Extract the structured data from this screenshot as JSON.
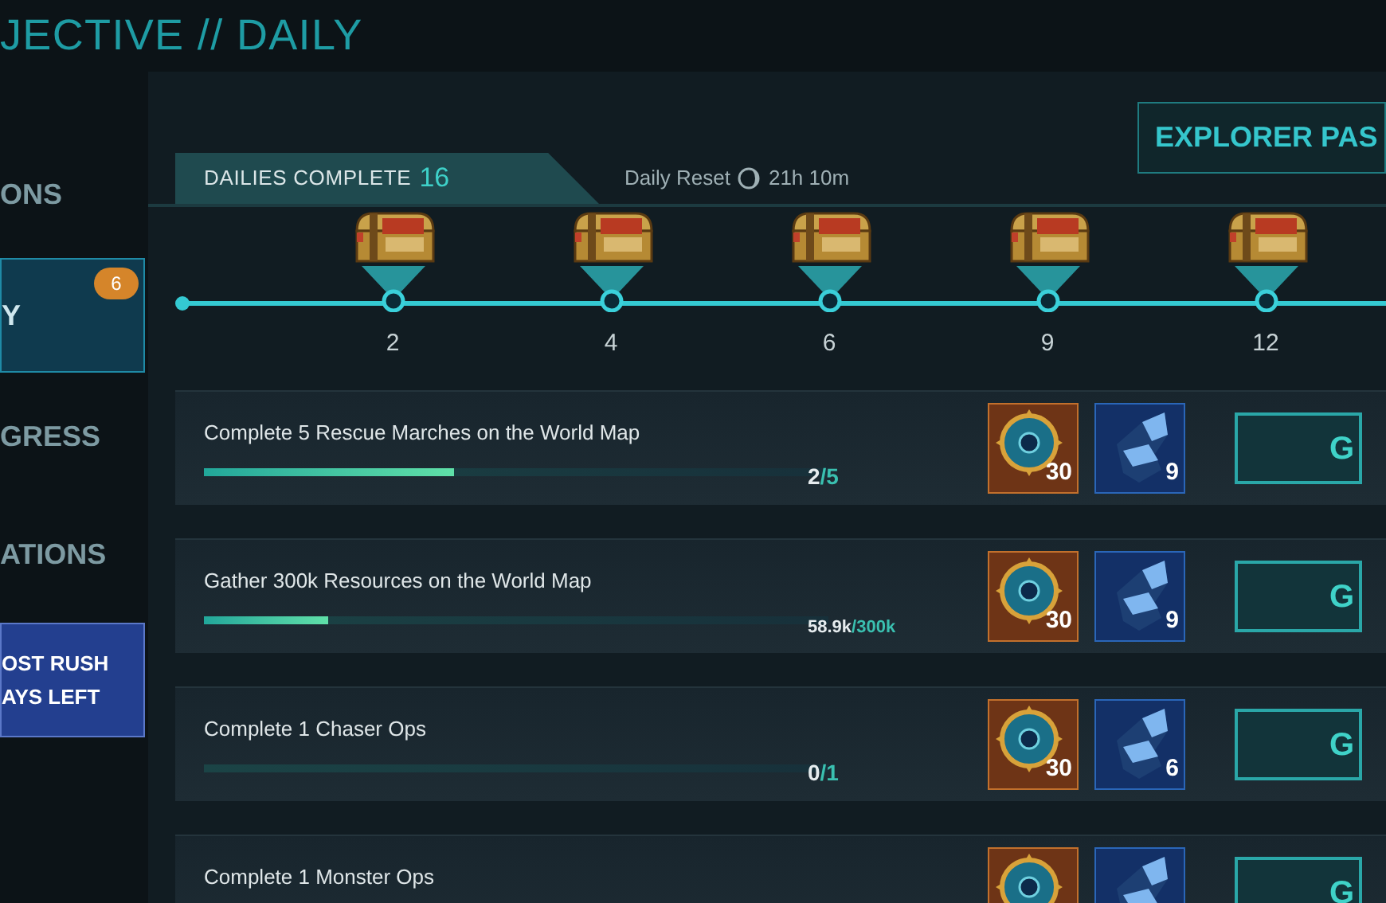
{
  "title": "JECTIVE // DAILY",
  "sidebar": {
    "items": [
      {
        "label": "ONS",
        "selected": false,
        "kind": "tab"
      },
      {
        "label": "Y",
        "selected": true,
        "kind": "tab",
        "badge": "6"
      },
      {
        "label": "GRESS",
        "selected": false,
        "kind": "tab"
      },
      {
        "label": "ATIONS",
        "selected": false,
        "kind": "tab"
      },
      {
        "lines": [
          "OST RUSH",
          "AYS LEFT"
        ],
        "kind": "event"
      }
    ]
  },
  "header": {
    "dailies_label": "DAILIES COMPLETE",
    "dailies_count": "16",
    "reset_label": "Daily Reset",
    "reset_time": "21h 10m",
    "pass_button": "EXPLORER PAS"
  },
  "milestones": [
    {
      "label": "2"
    },
    {
      "label": "4"
    },
    {
      "label": "6"
    },
    {
      "label": "9"
    },
    {
      "label": "12"
    }
  ],
  "tasks": [
    {
      "title": "Complete 5 Rescue Marches on the World Map",
      "level": 0.4,
      "done": "2",
      "total": "/5",
      "rewards": [
        {
          "kind": "compass",
          "count": "30"
        },
        {
          "kind": "crystal",
          "count": "9"
        }
      ],
      "button": "G"
    },
    {
      "title": "Gather 300k Resources on the World Map",
      "level": 0.2,
      "done": "58.9k",
      "total": "/300k",
      "small": true,
      "rewards": [
        {
          "kind": "compass",
          "count": "30"
        },
        {
          "kind": "crystal",
          "count": "9"
        }
      ],
      "button": "G"
    },
    {
      "title": "Complete 1 Chaser Ops",
      "level": 0,
      "done": "0",
      "total": "/1",
      "rewards": [
        {
          "kind": "compass",
          "count": "30"
        },
        {
          "kind": "crystal",
          "count": "6"
        }
      ],
      "button": "G"
    },
    {
      "title": "Complete 1 Monster Ops",
      "rewards": [
        {
          "kind": "compass"
        },
        {
          "kind": "crystal"
        }
      ],
      "button": "G"
    }
  ]
}
